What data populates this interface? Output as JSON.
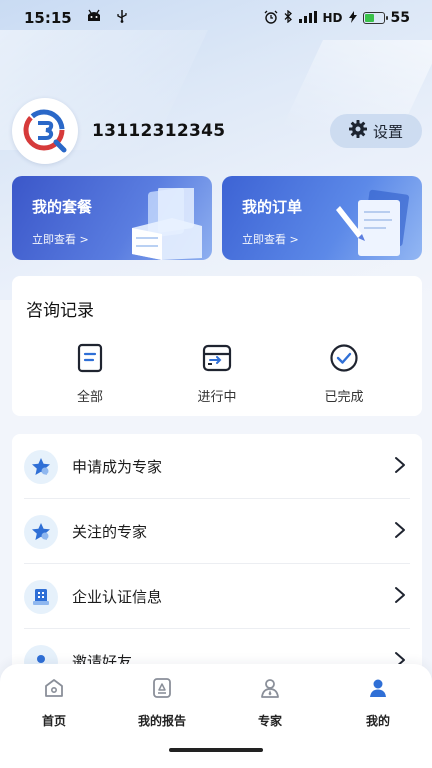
{
  "status_bar": {
    "time": "15:15",
    "network": "HD",
    "battery": "55",
    "battery_level": 0.55
  },
  "profile": {
    "phone": "13112312345",
    "settings_label": "设置"
  },
  "cards": {
    "package": {
      "title": "我的套餐",
      "sub": "立即查看 >"
    },
    "order": {
      "title": "我的订单",
      "sub": "立即查看 >"
    }
  },
  "consult": {
    "title": "咨询记录",
    "items": [
      {
        "label": "全部",
        "icon": "document-icon"
      },
      {
        "label": "进行中",
        "icon": "inbox-progress-icon"
      },
      {
        "label": "已完成",
        "icon": "check-circle-icon"
      }
    ]
  },
  "menu": {
    "items": [
      {
        "label": "申请成为专家",
        "icon": "star-badge-icon"
      },
      {
        "label": "关注的专家",
        "icon": "star-badge-icon"
      },
      {
        "label": "企业认证信息",
        "icon": "building-icon"
      },
      {
        "label": "邀请好友",
        "icon": "user-icon"
      }
    ]
  },
  "tabbar": {
    "tabs": [
      {
        "label": "首页",
        "icon": "home-icon"
      },
      {
        "label": "我的报告",
        "icon": "report-icon"
      },
      {
        "label": "专家",
        "icon": "expert-icon"
      },
      {
        "label": "我的",
        "icon": "person-icon"
      }
    ],
    "active": "我的"
  },
  "colors": {
    "accent": "#2f6fd6",
    "card_package": "#3b57c9",
    "card_order": "#3d63d4",
    "battery": "#3ac24a"
  }
}
